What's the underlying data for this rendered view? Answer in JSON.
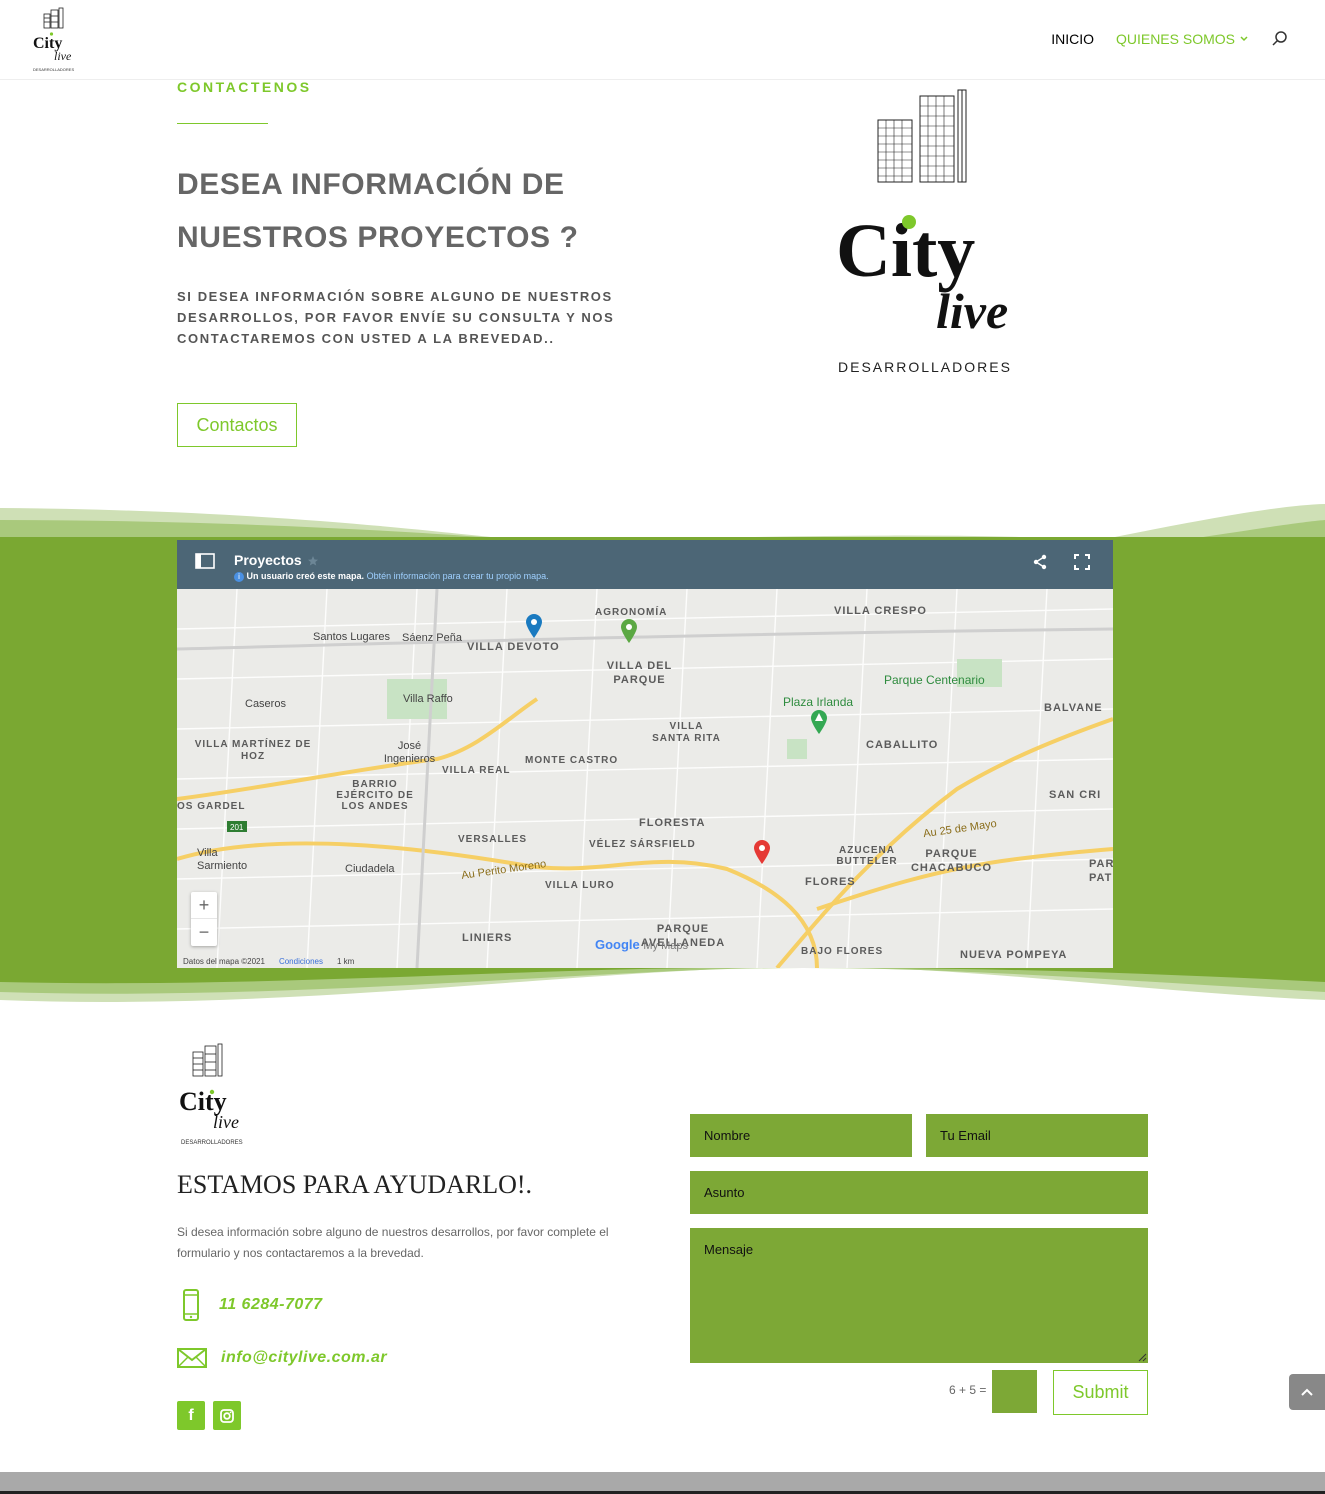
{
  "header": {
    "logo_alt": "City Live Desarrolladores",
    "nav": {
      "home": "INICIO",
      "about": "QUIENES SOMOS"
    }
  },
  "hero": {
    "eyebrow": "CONTACTENOS",
    "title_line1": "DESEA INFORMACIÓN DE",
    "title_line2": "NUESTROS PROYECTOS ?",
    "text": "SI DESEA INFORMACIÓN SOBRE ALGUNO DE NUESTROS DESARROLLOS, POR FAVOR ENVÍE SU CONSULTA Y NOS CONTACTAREMOS CON USTED A LA BREVEDAD..",
    "button": "Contactos"
  },
  "logo": {
    "name_top": "City",
    "name_bottom": "live",
    "tagline": "DESARROLLADORES"
  },
  "map": {
    "title": "Proyectos",
    "sub_text": "Un usuario creó este mapa.",
    "sub_link": "Obtén información para crear tu propio mapa.",
    "zoom_in": "+",
    "zoom_out": "−",
    "foot_data": "Datos del mapa ©2021",
    "foot_terms": "Condiciones",
    "foot_scale": "1 km",
    "google": "Google",
    "mymaps": "My Maps",
    "labels": {
      "villa_devoto": "VILLA DEVOTO",
      "agronomia": "AGRONOMÍA",
      "villa_crespo": "VILLA CRESPO",
      "santos_lugares": "Santos Lugares",
      "saenz_pena": "Sáenz Peña",
      "villa_del_parque": "VILLA DEL PARQUE",
      "parque_centenario": "Parque Centenario",
      "villa_raffo": "Villa Raffo",
      "caseros": "Caseros",
      "plaza_irlanda": "Plaza Irlanda",
      "balvanera": "BALVANE",
      "villa_martinez": "VILLA MARTÍNEZ DE HOZ",
      "jose_ingenieros": "José Ingenieros",
      "villa_santa_rita": "VILLA SANTA RITA",
      "caballito": "CABALLITO",
      "villa_real": "VILLA REAL",
      "monte_castro": "MONTE CASTRO",
      "barrio_ejercito": "BARRIO EJÉRCITO DE LOS ANDES",
      "san_cristobal": "SAN CRI",
      "os_gardel": "OS GARDEL",
      "floresta": "FLORESTA",
      "versalles": "VERSALLES",
      "velez": "VÉLEZ SÁRSFIELD",
      "azucena": "AZUCENA BUTTELER",
      "parque_chacabuco": "PARQUE CHACABUCO",
      "villa_sarmiento": "Villa Sarmiento",
      "ciudadela": "Ciudadela",
      "villa_luro": "VILLA LURO",
      "flores": "FLORES",
      "parque_pat": "PAR PAT",
      "liniers": "LINIERS",
      "parque_avellaneda": "PARQUE AVELLANEDA",
      "bajo_flores": "BAJO FLORES",
      "nueva_pompeya": "NUEVA POMPEYA",
      "au_perito": "Au Perito Moreno",
      "au_25": "Au 25 de Mayo",
      "ruta_201": "201"
    }
  },
  "footer": {
    "title": "ESTAMOS PARA AYUDARLO!.",
    "text": "Si desea información sobre alguno de nuestros desarrollos, por favor complete el formulario y nos contactaremos a la brevedad.",
    "phone": "11 6284-7077",
    "email": "info@citylive.com.ar"
  },
  "form": {
    "name": "Nombre",
    "email": "Tu Email",
    "subject": "Asunto",
    "message": "Mensaje",
    "captcha": "6 + 5 =",
    "submit": "Submit"
  },
  "colors": {
    "accent": "#7ec82b",
    "band": "#7aa832",
    "field": "#7da836"
  }
}
